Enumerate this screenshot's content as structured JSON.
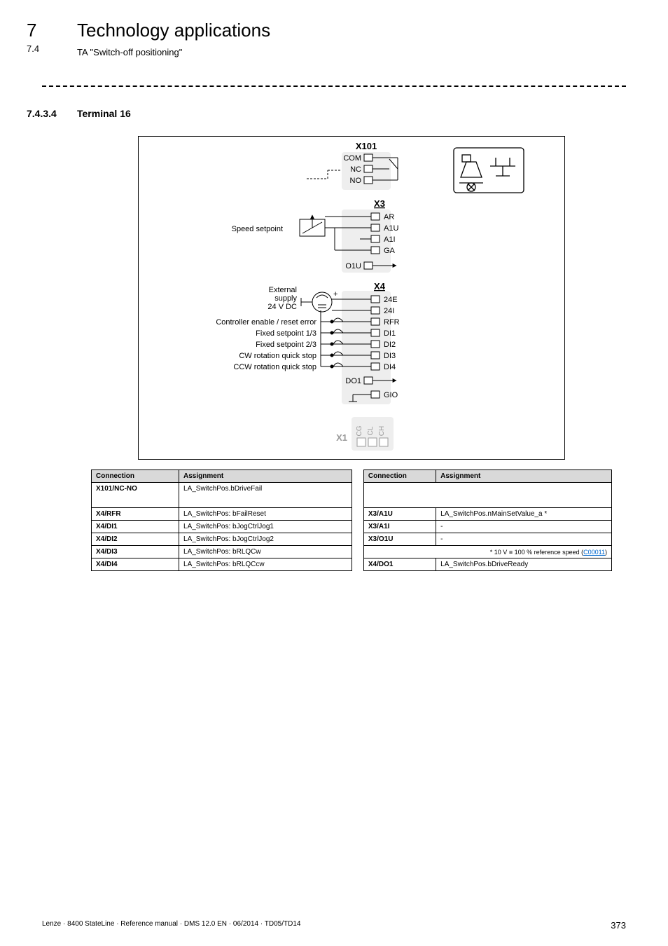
{
  "header": {
    "chapter_number": "7",
    "chapter_title": "Technology applications",
    "section_number": "7.4",
    "section_title": "TA \"Switch-off positioning\""
  },
  "section": {
    "number": "7.4.3.4",
    "title": "Terminal 16"
  },
  "diagram": {
    "blocks": {
      "x101": "X101",
      "x3": "X3",
      "x4": "X4",
      "x1": "X1"
    },
    "x101_pins": [
      "COM",
      "NC",
      "NO"
    ],
    "x3_pins": [
      "AR",
      "A1U",
      "A1I",
      "GA",
      "O1U"
    ],
    "x3_label": "Speed setpoint",
    "x4_pins": [
      "24E",
      "24I",
      "RFR",
      "DI1",
      "DI2",
      "DI3",
      "DI4",
      "DO1",
      "GIO"
    ],
    "x4_supply_lines": [
      "External",
      "supply",
      "24 V DC"
    ],
    "x4_labels": [
      "Controller enable / reset error",
      "Fixed setpoint 1/3",
      "Fixed setpoint 2/3",
      "CW rotation quick stop",
      "CCW rotation quick stop"
    ],
    "x1_pins": [
      "CG",
      "CL",
      "CH"
    ]
  },
  "tables": {
    "left": {
      "headers": [
        "Connection",
        "Assignment"
      ],
      "rows": [
        [
          "X101/NC-NO",
          "LA_SwitchPos.bDriveFail"
        ],
        [
          "X4/RFR",
          "LA_SwitchPos: bFailReset"
        ],
        [
          "X4/DI1",
          "LA_SwitchPos: bJogCtrlJog1"
        ],
        [
          "X4/DI2",
          "LA_SwitchPos: bJogCtrlJog2"
        ],
        [
          "X4/DI3",
          "LA_SwitchPos: bRLQCw"
        ],
        [
          "X4/DI4",
          "LA_SwitchPos: bRLQCcw"
        ]
      ]
    },
    "right": {
      "headers": [
        "Connection",
        "Assignment"
      ],
      "rows": [
        [
          "X3/A1U",
          "LA_SwitchPos.nMainSetValue_a *"
        ],
        [
          "X3/A1I",
          "-"
        ],
        [
          "X3/O1U",
          "-"
        ]
      ],
      "note_prefix": "* 10 V ≡ 100 % reference speed (",
      "note_link": "C00011",
      "note_suffix": ")",
      "last": [
        "X4/DO1",
        "LA_SwitchPos.bDriveReady"
      ]
    }
  },
  "footer": {
    "left": "Lenze · 8400 StateLine · Reference manual · DMS 12.0 EN · 06/2014 · TD05/TD14",
    "page": "373"
  }
}
